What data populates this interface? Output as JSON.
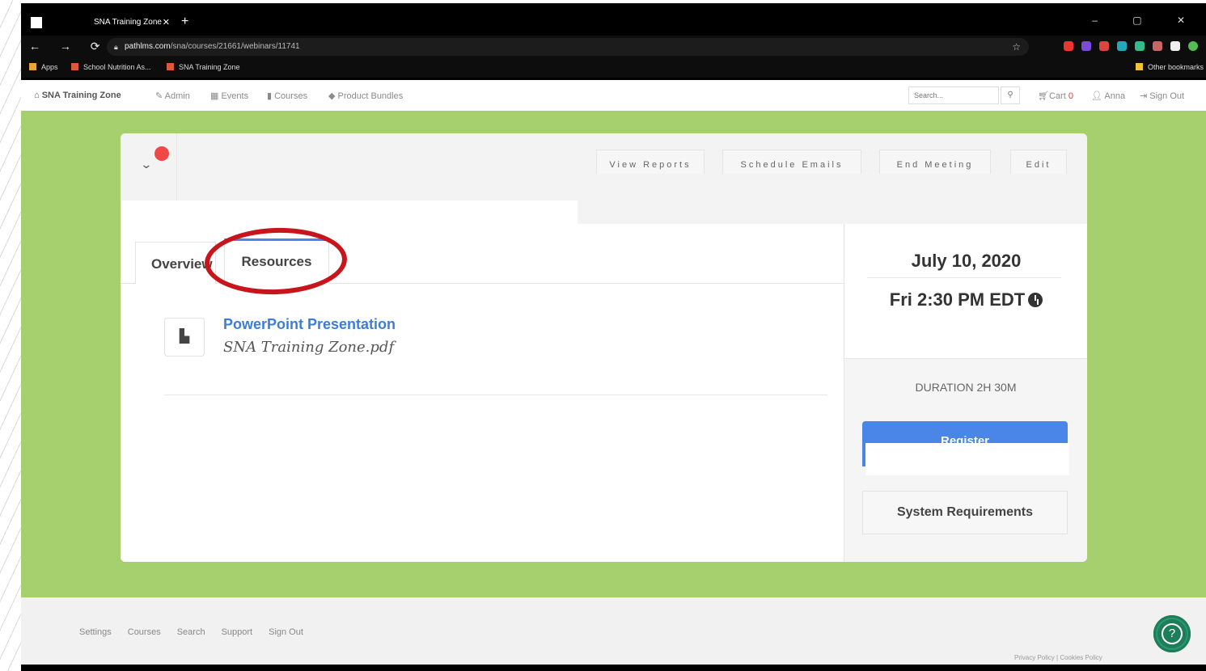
{
  "browser": {
    "tab_title": "SNA Training Zone",
    "tab_close": "✕",
    "new_tab": "+",
    "url_domain": "pathlms.com",
    "url_path": "/sna/courses/21661/webinars/11741",
    "bookmarks": [
      "Apps",
      "School Nutrition As...",
      "SNA Training Zone"
    ],
    "other_bookmarks": "Other bookmarks"
  },
  "nav": {
    "brand": "SNA Training Zone",
    "items": [
      "Admin",
      "Events",
      "Courses",
      "Product Bundles"
    ],
    "search_placeholder": "Search...",
    "cart_label": "Cart",
    "cart_count": "0",
    "user": "Anna",
    "signout": "Sign Out"
  },
  "webinar": {
    "top_buttons": [
      "View Reports",
      "Schedule Emails",
      "End Meeting",
      "Edit"
    ],
    "tabs": [
      "Overview",
      "Resources"
    ],
    "active_tab": "Resources",
    "resource": {
      "title": "PowerPoint Presentation",
      "filename": "SNA Training Zone.pdf"
    },
    "date": "July 10, 2020",
    "time": "Fri 2:30 PM EDT",
    "duration": "DURATION 2H 30M",
    "register_label": "Register",
    "system_requirements": "System Requirements"
  },
  "footer": {
    "links": [
      "Settings",
      "Courses",
      "Search",
      "Support",
      "Sign Out"
    ],
    "legal": "Privacy Policy | Cookies Policy"
  },
  "colors": {
    "page_green": "#a6d06e",
    "link_blue": "#3d7dd8",
    "annotation_red": "#c8141b",
    "help_green": "#1e7d5a"
  }
}
